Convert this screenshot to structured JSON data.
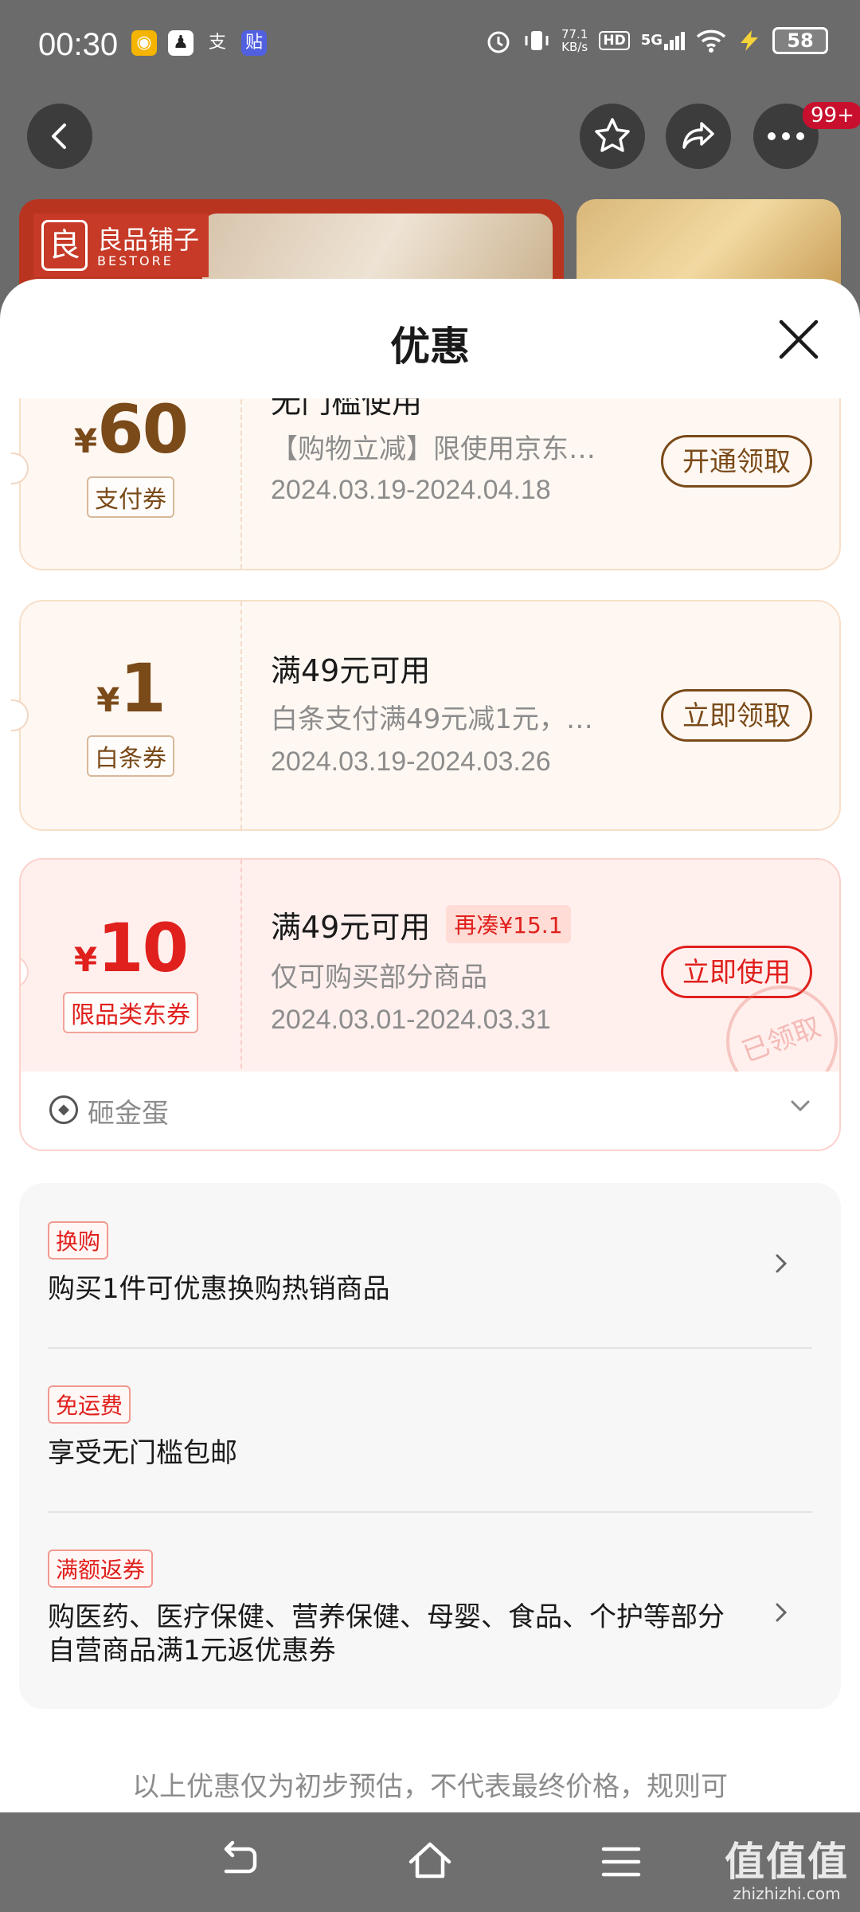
{
  "status_bar": {
    "time": "00:30",
    "apps": [
      {
        "icon": "app-icon-yellow",
        "glyph": "◉",
        "color": "#f5b400"
      },
      {
        "icon": "qq-icon",
        "glyph": "♟",
        "color": "#222222"
      },
      {
        "icon": "alipay-icon",
        "glyph": "支",
        "color": "transparent"
      },
      {
        "icon": "tieba-icon",
        "glyph": "贴",
        "color": "#5160e0"
      }
    ],
    "net_speed": "77.1",
    "net_unit": "KB/s",
    "hd": "HD",
    "signal": "5G",
    "battery": "58"
  },
  "top_nav": {
    "badge": "99+"
  },
  "banner": {
    "logo_main": "良品铺子",
    "logo_sub": "BESTORE",
    "logo_mark": "良"
  },
  "sheet": {
    "title": "优惠",
    "coupons": [
      {
        "currency": "¥",
        "amount": "60",
        "type": "支付券",
        "condition": "无门槛使用",
        "desc": "【购物立减】限使用京东…",
        "date": "2024.03.19-2024.04.18",
        "button": "开通领取"
      },
      {
        "currency": "¥",
        "amount": "1",
        "type": "白条券",
        "condition": "满49元可用",
        "desc": "白条支付满49元减1元，…",
        "date": "2024.03.19-2024.03.26",
        "button": "立即领取"
      },
      {
        "currency": "¥",
        "amount": "10",
        "type": "限品类东券",
        "condition": "满49元可用",
        "extra": "再凑¥15.1",
        "desc": "仅可购买部分商品",
        "date": "2024.03.01-2024.03.31",
        "button": "立即使用",
        "stamp": "已领取"
      }
    ],
    "egg": {
      "label": "砸金蛋"
    },
    "promos": [
      {
        "tag": "换购",
        "text": "购买1件可优惠换购热销商品"
      },
      {
        "tag": "免运费",
        "text": "享受无门槛包邮"
      },
      {
        "tag": "满额返券",
        "text": "购医药、医疗保健、营养保健、母婴、食品、个护等部分自营商品满1元返优惠券"
      }
    ],
    "disclaimer": "以上优惠仅为初步预估，不代表最终价格，规则可"
  },
  "watermark": {
    "main": "值值值",
    "sub": "zhizhizhi.com"
  },
  "colors": {
    "accent_red": "#e0201d",
    "coupon_brown": "#7a4a19"
  }
}
